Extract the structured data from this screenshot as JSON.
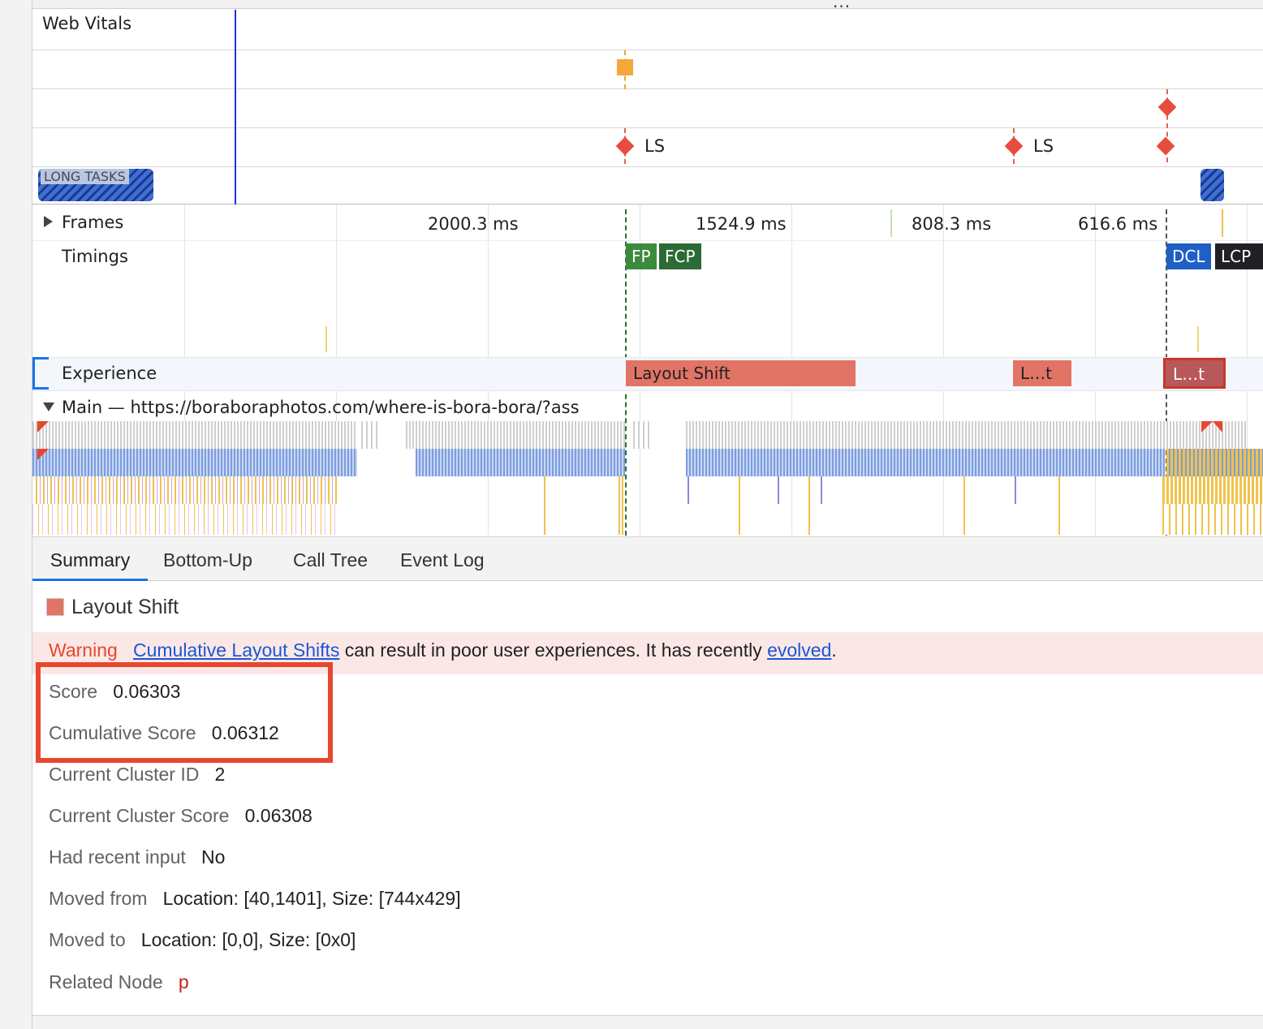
{
  "top_dots": "...",
  "tracks": {
    "web_vitals": "Web Vitals",
    "ls_marker_1": "LS",
    "ls_marker_2": "LS",
    "long_tasks": "LONG TASKS",
    "frames": "Frames",
    "frame_times": [
      "2000.3 ms",
      "1524.9 ms",
      "808.3 ms",
      "616.6 ms"
    ],
    "timings": "Timings",
    "timing_chips": {
      "fp": "FP",
      "fcp": "FCP",
      "dcl": "DCL",
      "lcp": "LCP"
    },
    "experience": "Experience",
    "experience_bars": [
      "Layout Shift",
      "L…t",
      "L…t"
    ],
    "main": "Main — https://boraboraphotos.com/where-is-bora-bora/?ass"
  },
  "colors": {
    "cursor": "#1c34d6",
    "layout_shift": "#e27466",
    "fp": "#3c8a3c",
    "fcp": "#2c6b35",
    "dcl": "#1f5fc6",
    "lcp": "#202124",
    "highlight_box": "#e8462f",
    "warning": "#e8462f"
  },
  "tabs": [
    {
      "label": "Summary",
      "active": true
    },
    {
      "label": "Bottom-Up",
      "active": false
    },
    {
      "label": "Call Tree",
      "active": false
    },
    {
      "label": "Event Log",
      "active": false
    }
  ],
  "summary": {
    "title": "Layout Shift",
    "warning_label": "Warning",
    "warning_link": "Cumulative Layout Shifts",
    "warning_text": "can result in poor user experiences. It has recently",
    "warning_link2": "evolved",
    "warning_end": ".",
    "rows": [
      {
        "key": "Score",
        "value": "0.06303"
      },
      {
        "key": "Cumulative Score",
        "value": "0.06312"
      },
      {
        "key": "Current Cluster ID",
        "value": "2"
      },
      {
        "key": "Current Cluster Score",
        "value": "0.06308"
      },
      {
        "key": "Had recent input",
        "value": "No"
      },
      {
        "key": "Moved from",
        "value": "Location: [40,1401], Size: [744x429]"
      },
      {
        "key": "Moved to",
        "value": "Location: [0,0], Size: [0x0]"
      },
      {
        "key": "Related Node",
        "value": "p"
      }
    ]
  }
}
